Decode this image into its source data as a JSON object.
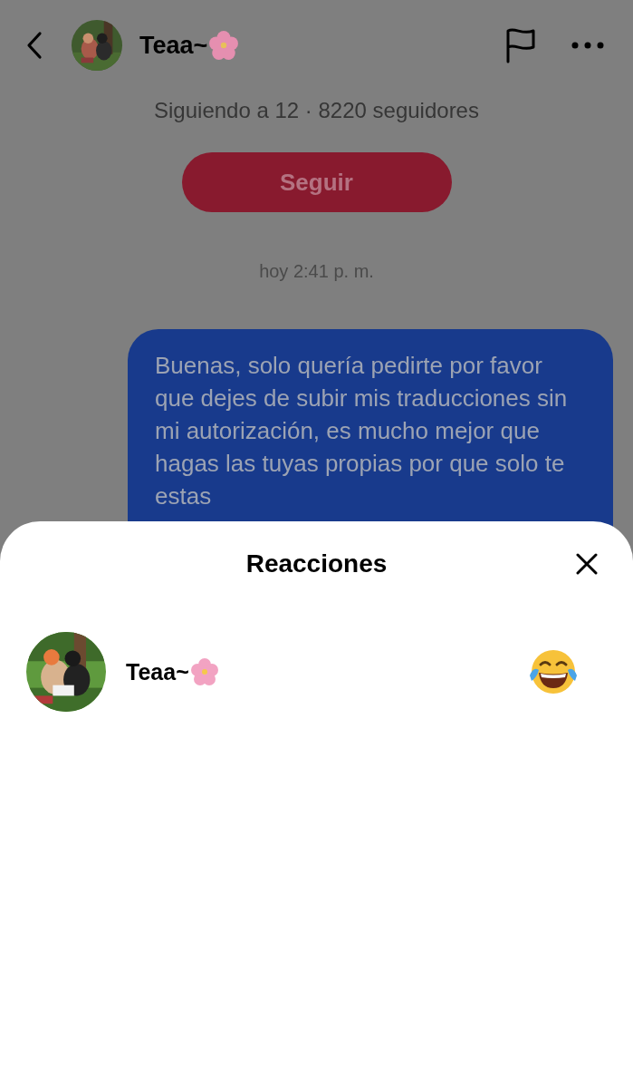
{
  "header": {
    "name": "Teaa~"
  },
  "profile": {
    "stats": "Siguiendo a 12 · 8220 seguidores",
    "follow_button": "Seguir"
  },
  "chat": {
    "timestamp": "hoy 2:41 p. m.",
    "messages": [
      {
        "text": "Buenas, solo quería pedirte por favor que dejes de subir mis traducciones sin mi autorización, es mucho mejor que hagas las tuyas propias por que solo te estas"
      }
    ]
  },
  "sheet": {
    "title": "Reacciones",
    "reactions": [
      {
        "name": "Teaa~"
      }
    ]
  }
}
